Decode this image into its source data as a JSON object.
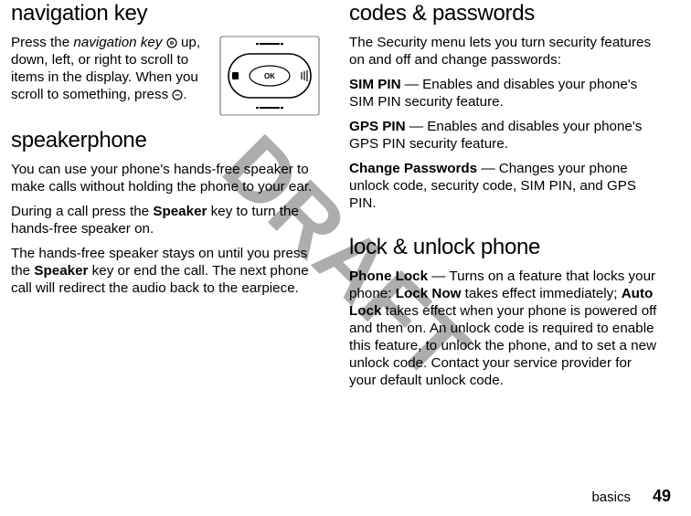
{
  "watermark": "DRAFT",
  "left": {
    "h1": "navigation key",
    "nav_p_a": "Press the ",
    "nav_p_b": "navigation key",
    "nav_p_c": " up, down, left, or right to scroll to items in the display. When you scroll to something, press ",
    "nav_p_d": ".",
    "h2": "speakerphone",
    "sp_p1": "You can use your phone's hands-free speaker to make calls without holding the phone to your ear.",
    "sp_p2_a": "During a call press the ",
    "sp_p2_b": "Speaker",
    "sp_p2_c": " key to turn the hands-free speaker on.",
    "sp_p3_a": "The hands-free speaker stays on until you press the ",
    "sp_p3_b": "Speaker",
    "sp_p3_c": " key or end the call. The next phone call will redirect the audio back to the earpiece."
  },
  "right": {
    "h1": "codes & passwords",
    "c_p1": "The Security menu lets you turn security features on and off and change passwords:",
    "sim_a": "SIM PIN",
    "sim_b": " — Enables and disables your phone's SIM PIN security feature.",
    "gps_a": "GPS PIN",
    "gps_b": " — Enables and disables your phone's GPS PIN security feature.",
    "chg_a": "Change Passwords",
    "chg_b": " — Changes your phone unlock code, security code, SIM PIN, and GPS PIN.",
    "h2": "lock & unlock phone",
    "lock_a": "Phone Lock",
    "lock_b": " — Turns on a feature that locks your phone: ",
    "lock_c": "Lock Now",
    "lock_d": " takes effect immediately; ",
    "lock_e": "Auto Lock",
    "lock_f": " takes effect when your phone is powered off and then on. An unlock code is required to enable this feature, to unlock the phone, and to set a new unlock code. Contact your service provider for your default unlock code."
  },
  "footer": {
    "section": "basics",
    "page": "49"
  },
  "icons": {
    "ok": "OK"
  }
}
